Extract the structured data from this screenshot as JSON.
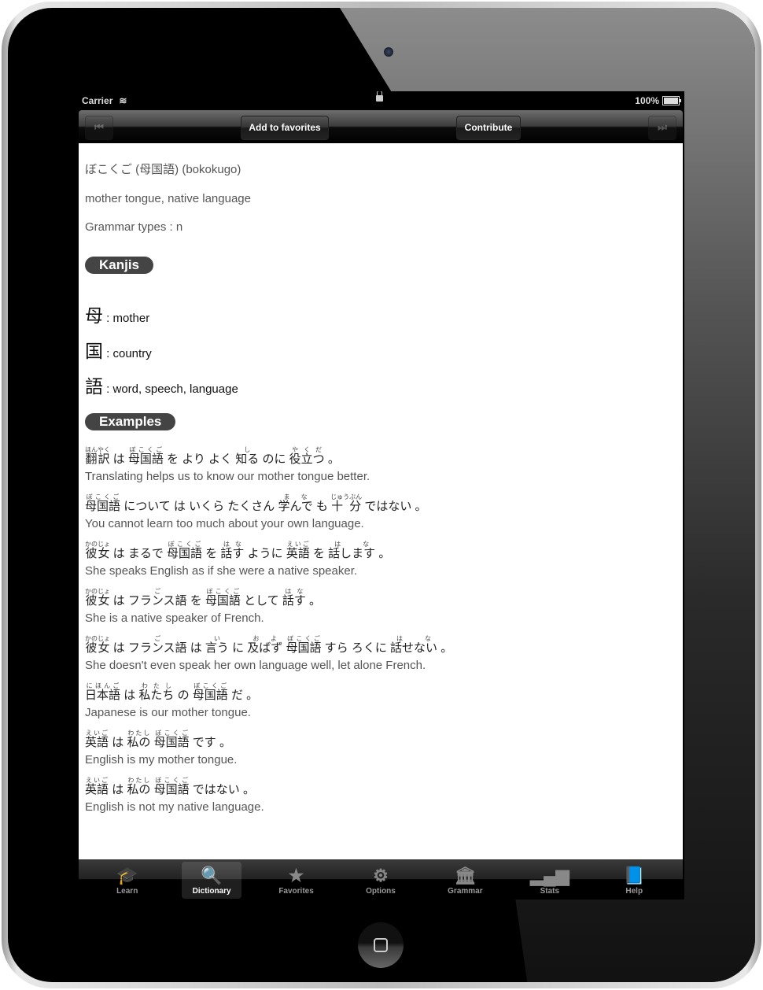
{
  "status": {
    "carrier": "Carrier",
    "battery": "100%",
    "battery_level": 1.0
  },
  "toolbar": {
    "prev_icon": "rewind-icon",
    "prev_glyph": "⏮",
    "next_icon": "fast-forward-icon",
    "next_glyph": "⏭",
    "add_favorites": "Add to favorites",
    "contribute": "Contribute"
  },
  "entry": {
    "heading": "ぼこくご (母国語) (bokokugo)",
    "meaning": "mother tongue, native language",
    "grammar": "Grammar types : n",
    "kanjis_label": "Kanjis",
    "kanjis": [
      {
        "char": "母",
        "meaning": " : mother"
      },
      {
        "char": "国",
        "meaning": " : country"
      },
      {
        "char": "語",
        "meaning": " : word, speech, language"
      }
    ],
    "examples_label": "Examples",
    "examples": [
      {
        "jp": [
          [
            "翻訳",
            "ほんやく"
          ],
          [
            "は",
            ""
          ],
          [
            "母国語",
            "ぼこくご"
          ],
          [
            "を",
            ""
          ],
          [
            "より",
            ""
          ],
          [
            "よく",
            ""
          ],
          [
            "知る",
            "し"
          ],
          [
            "のに",
            ""
          ],
          [
            "役立つ",
            "やくだ"
          ],
          [
            "。",
            ""
          ]
        ],
        "en": "Translating helps us to know our mother tongue better."
      },
      {
        "jp": [
          [
            "母国語",
            "ぼこくご"
          ],
          [
            "について",
            ""
          ],
          [
            "は",
            ""
          ],
          [
            "いくら",
            ""
          ],
          [
            "たくさん",
            ""
          ],
          [
            "学んで",
            "まな"
          ],
          [
            "も",
            ""
          ],
          [
            "十 分",
            "じゅうぶん"
          ],
          [
            "ではない",
            ""
          ],
          [
            "。",
            ""
          ]
        ],
        "en": "You cannot learn too much about your own language."
      },
      {
        "jp": [
          [
            "彼女",
            "かのじょ"
          ],
          [
            "は",
            ""
          ],
          [
            "まるで",
            ""
          ],
          [
            "母国語",
            "ぼこくご"
          ],
          [
            "を",
            ""
          ],
          [
            "話す",
            "はな"
          ],
          [
            "ように",
            ""
          ],
          [
            "英語",
            "えいご"
          ],
          [
            "を",
            ""
          ],
          [
            "話します",
            "はな"
          ],
          [
            "。",
            ""
          ]
        ],
        "en": "She speaks English as if she were a native speaker."
      },
      {
        "jp": [
          [
            "彼女",
            "かのじょ"
          ],
          [
            "は",
            ""
          ],
          [
            "フランス語",
            "ご"
          ],
          [
            "を",
            ""
          ],
          [
            "母国語",
            "ぼこくご"
          ],
          [
            "として",
            ""
          ],
          [
            "話す",
            "はな"
          ],
          [
            "。",
            ""
          ]
        ],
        "en": "She is a native speaker of French."
      },
      {
        "jp": [
          [
            "彼女",
            "かのじょ"
          ],
          [
            "は",
            ""
          ],
          [
            "フランス語",
            "ご"
          ],
          [
            "は",
            ""
          ],
          [
            "言う",
            "い"
          ],
          [
            "に",
            ""
          ],
          [
            "及ばず",
            "およ"
          ],
          [
            "母国語",
            "ぼこくご"
          ],
          [
            "すら",
            ""
          ],
          [
            "ろくに",
            ""
          ],
          [
            "話せない",
            "はな"
          ],
          [
            "。",
            ""
          ]
        ],
        "en": "She doesn't even speak her own language well, let alone French."
      },
      {
        "jp": [
          [
            "日本語",
            "にほんご"
          ],
          [
            "は",
            ""
          ],
          [
            "私たち",
            "わたし"
          ],
          [
            "の",
            ""
          ],
          [
            "母国語",
            "ぼこくご"
          ],
          [
            "だ",
            ""
          ],
          [
            "。",
            ""
          ]
        ],
        "en": "Japanese is our mother tongue."
      },
      {
        "jp": [
          [
            "英語",
            "えいご"
          ],
          [
            "は",
            ""
          ],
          [
            "私の",
            "わたし"
          ],
          [
            "母国語",
            "ぼこくご"
          ],
          [
            "です",
            ""
          ],
          [
            "。",
            ""
          ]
        ],
        "en": "English is my mother tongue."
      },
      {
        "jp": [
          [
            "英語",
            "えいご"
          ],
          [
            "は",
            ""
          ],
          [
            "私の",
            "わたし"
          ],
          [
            "母国語",
            "ぼこくご"
          ],
          [
            "ではない",
            ""
          ],
          [
            "。",
            ""
          ]
        ],
        "en": "English is not my native language."
      }
    ]
  },
  "tabs": [
    {
      "label": "Learn",
      "icon": "graduation-cap-icon",
      "glyph": "🎓",
      "active": false
    },
    {
      "label": "Dictionary",
      "icon": "search-icon",
      "glyph": "🔍",
      "active": true
    },
    {
      "label": "Favorites",
      "icon": "star-icon",
      "glyph": "★",
      "active": false
    },
    {
      "label": "Options",
      "icon": "gear-icon",
      "glyph": "⚙",
      "active": false
    },
    {
      "label": "Grammar",
      "icon": "building-icon",
      "glyph": "🏛",
      "active": false
    },
    {
      "label": "Stats",
      "icon": "bar-chart-icon",
      "glyph": "▂▄▆",
      "active": false
    },
    {
      "label": "Help",
      "icon": "book-icon",
      "glyph": "📘",
      "active": false
    }
  ]
}
